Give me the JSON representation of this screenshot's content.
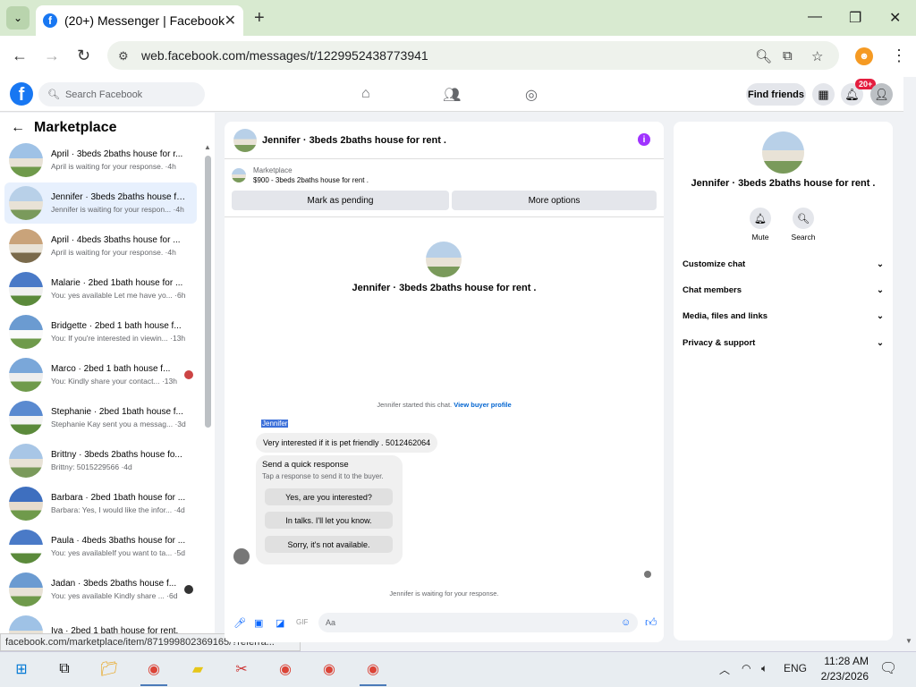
{
  "browser": {
    "tab_title": "(20+) Messenger | Facebook",
    "url": "web.facebook.com/messages/t/1229952438773941",
    "status_url": "facebook.com/marketplace/item/871999802369165/?referra..."
  },
  "fb": {
    "search_placeholder": "Search Facebook",
    "find_friends": "Find friends",
    "notif_badge": "20+"
  },
  "sidebar": {
    "title": "Marketplace",
    "conversations": [
      {
        "title": "April · 3beds 2baths house for r...",
        "preview": "April is waiting for your response. ·4h"
      },
      {
        "title": "Jennifer · 3beds 2baths house fo...",
        "preview": "Jennifer is waiting for your respon... ·4h"
      },
      {
        "title": "April · 4beds 3baths house for ...",
        "preview": "April is waiting for your response. ·4h"
      },
      {
        "title": "Malarie · 2bed 1bath house for ...",
        "preview": "You: yes available Let me have yo... ·6h"
      },
      {
        "title": "Bridgette · 2bed 1 bath house f...",
        "preview": "You: If you're interested in viewin... ·13h"
      },
      {
        "title": "Marco · 2bed 1 bath house f...",
        "preview": "You: Kindly share your contact... ·13h"
      },
      {
        "title": "Stephanie · 2bed 1bath house f...",
        "preview": "Stephanie Kay sent you a messag... ·3d"
      },
      {
        "title": "Brittny · 3beds 2baths house fo...",
        "preview": "Brittny: 5015229566 ·4d"
      },
      {
        "title": "Barbara · 2bed 1bath house for ...",
        "preview": "Barbara: Yes, I would like the infor... ·4d"
      },
      {
        "title": "Paula · 4beds 3baths house for ...",
        "preview": "You: yes availableIf you want to ta... ·5d"
      },
      {
        "title": "Jadan · 3beds 2baths house f...",
        "preview": "You: yes available Kindly share ... ·6d"
      },
      {
        "title": "Iva · 2bed 1 bath house for rent.",
        "preview": ""
      }
    ]
  },
  "chat": {
    "header_title": "Jennifer · 3beds 2baths house for rent .",
    "marketplace_label": "Marketplace",
    "listing": "$900 - 3beds 2baths house for rent .",
    "mark_pending": "Mark as pending",
    "more_options": "More options",
    "center_title": "Jennifer · 3beds 2baths house for rent .",
    "started_text": "Jennifer started this chat.",
    "view_profile": "View buyer profile",
    "sender_name": "Jennifer",
    "message": "Very interested if it is pet friendly . 5012462064",
    "quick_title": "Send a quick response",
    "quick_sub": "Tap a response to send it to the buyer.",
    "quick_1": "Yes, are you interested?",
    "quick_2": "In talks. I'll let you know.",
    "quick_3": "Sorry, it's not available.",
    "waiting": "Jennifer is waiting for your response.",
    "input_placeholder": "Aa"
  },
  "panel": {
    "title": "Jennifer · 3beds 2baths house for rent .",
    "mute": "Mute",
    "search": "Search",
    "items": [
      "Customize chat",
      "Chat members",
      "Media, files and links",
      "Privacy & support"
    ]
  },
  "taskbar": {
    "lang": "ENG",
    "time": "11:28 AM",
    "date": "2/23/2026"
  }
}
